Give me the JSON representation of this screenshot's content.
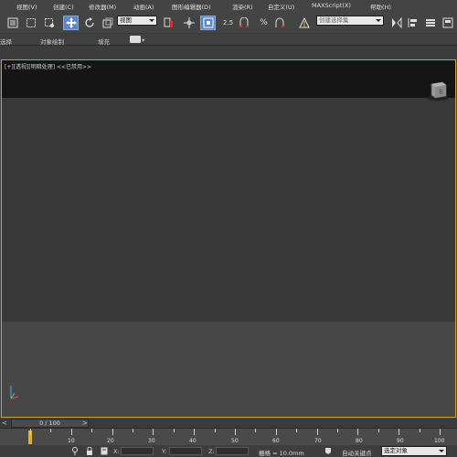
{
  "menubar": {
    "items": [
      "视图(V)",
      "创建(C)",
      "修改器(M)",
      "动画(A)",
      "图形编辑器(D)",
      "渲染(R)",
      "自定义(U)",
      "MAXScript(X)",
      "帮助(H)"
    ]
  },
  "toolbar": {
    "viewport_dropdown": "视图",
    "snap_percent_label": "2.5",
    "named_selection_placeholder": "创建选择集"
  },
  "ribbon": {
    "items": [
      "选择",
      "对象绘制",
      "填充"
    ]
  },
  "viewport": {
    "label": "[+][透视][明暗处理] <<已禁用>>",
    "viewcube_label": "左"
  },
  "timeslider": {
    "left_arrow": "<",
    "frame_label": "0 / 100",
    "right_arrow": ">"
  },
  "trackbar": {
    "ticks": [
      "10",
      "20",
      "30",
      "40",
      "50",
      "60",
      "70",
      "80",
      "90",
      "100"
    ]
  },
  "statusbar": {
    "x_label": "X:",
    "y_label": "Y:",
    "z_label": "Z:",
    "grid": "栅格 = 10.0mm",
    "auto_key": "自动关键点",
    "selection_dropdown": "选定对象"
  },
  "colors": {
    "accent_blue": "#5b87c8",
    "viewport_border": "#c8a02a",
    "background": "#444444"
  }
}
